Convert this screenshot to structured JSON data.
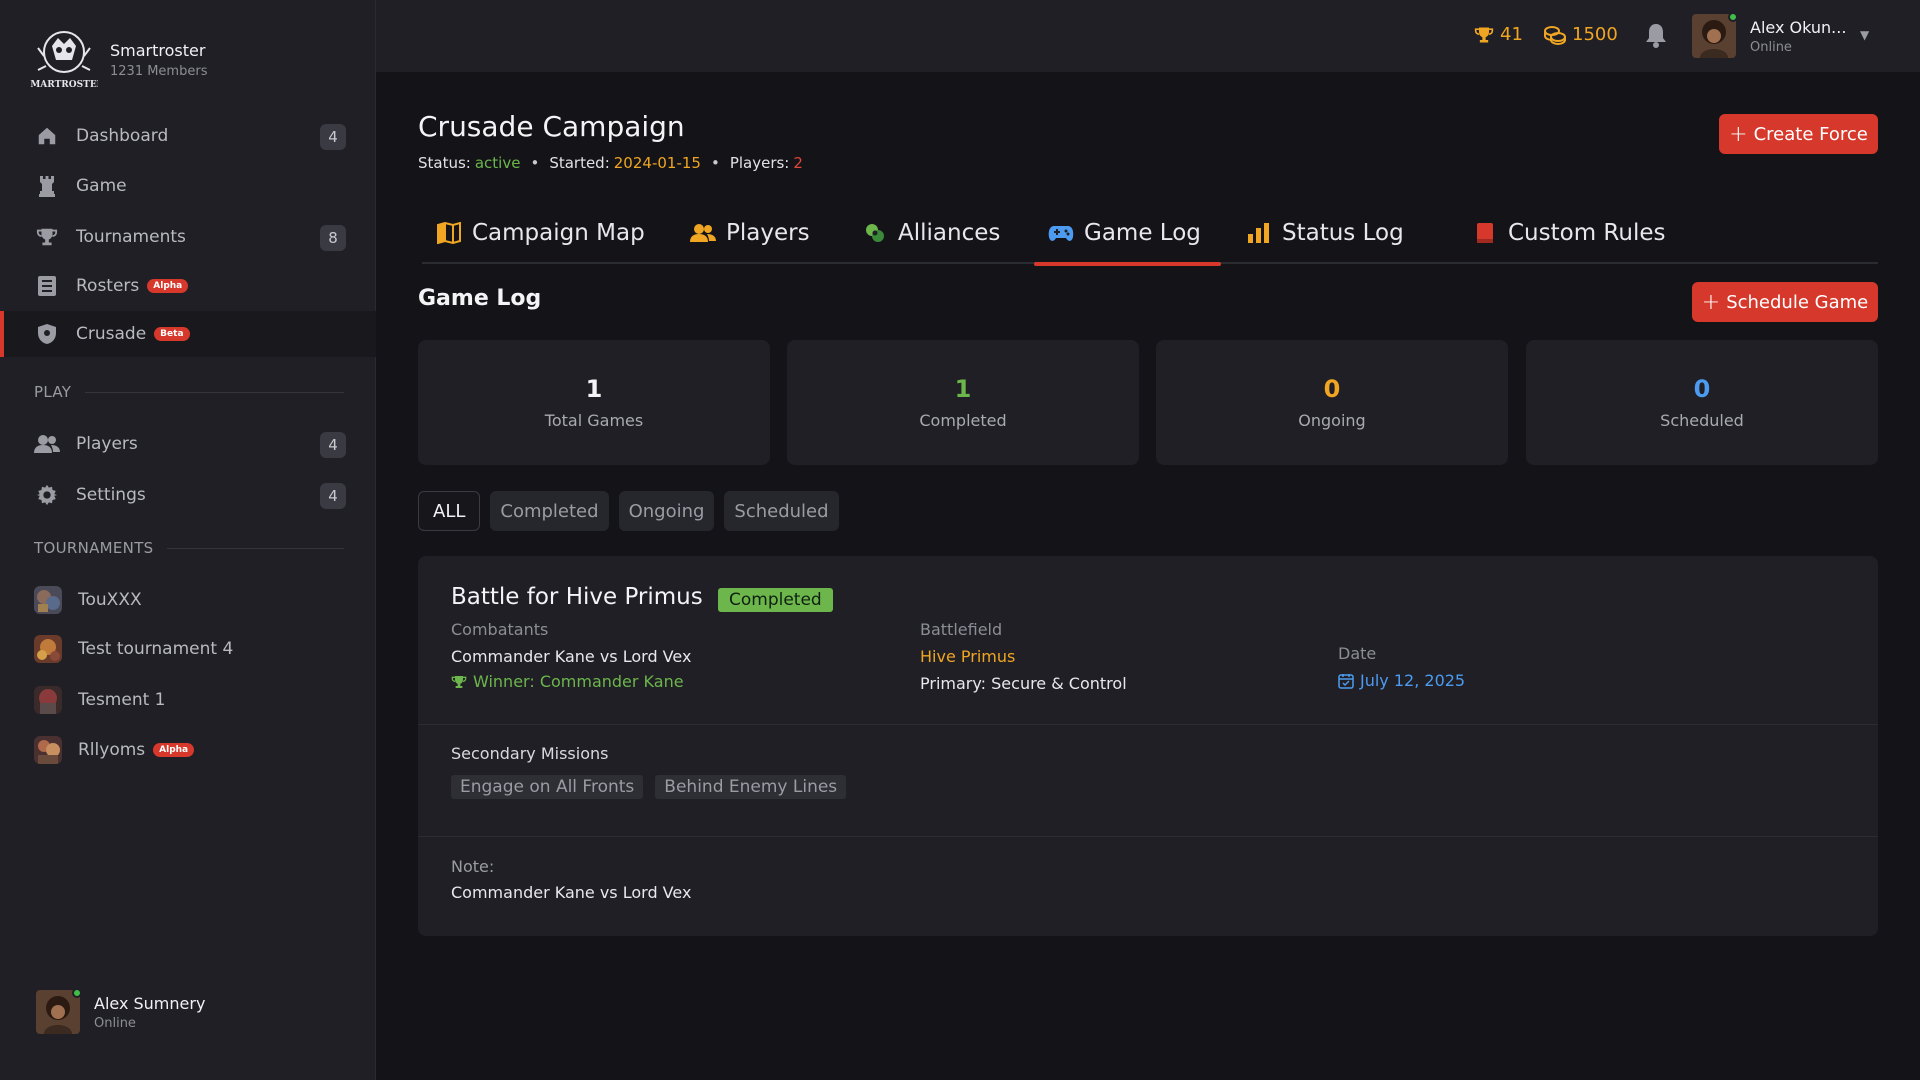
{
  "colors": {
    "accent": "#d6392c",
    "green": "#6cb64b",
    "orange": "#f0a623",
    "blue": "#4d9bf0",
    "sidebar_bg": "#1f1f25",
    "page_bg": "#131318"
  },
  "brand": {
    "name": "Smartroster",
    "members": "1231 Members",
    "logo_text": "SMARTROSTER"
  },
  "sidebar": {
    "items": [
      {
        "label": "Dashboard",
        "icon": "home-icon",
        "count": "4"
      },
      {
        "label": "Game",
        "icon": "chess-rook-icon"
      },
      {
        "label": "Tournaments",
        "icon": "trophy-icon",
        "count": "8"
      },
      {
        "label": "Rosters",
        "icon": "list-icon",
        "badge": "Alpha"
      },
      {
        "label": "Crusade",
        "icon": "shield-icon",
        "badge": "Beta",
        "active": true
      }
    ],
    "play_heading": "PLAY",
    "play_items": [
      {
        "label": "Players",
        "icon": "users-icon",
        "count": "4"
      },
      {
        "label": "Settings",
        "icon": "gear-icon",
        "count": "4"
      }
    ],
    "tournaments_heading": "TOURNAMENTS",
    "tournaments": [
      {
        "label": "TouXXX"
      },
      {
        "label": "Test tournament 4"
      },
      {
        "label": "Tesment 1"
      },
      {
        "label": "Rllyoms",
        "badge": "Alpha"
      }
    ],
    "user": {
      "name": "Alex Sumnery",
      "status": "Online"
    }
  },
  "topbar": {
    "trophies": "41",
    "coins": "1500",
    "user": {
      "name": "Alex Okun...",
      "status": "Online"
    }
  },
  "campaign": {
    "title": "Crusade Campaign",
    "status_label": "Status:",
    "status_value": "active",
    "started_label": "Started:",
    "started_value": "2024-01-15",
    "players_label": "Players:",
    "players_value": "2",
    "create_force_label": "Create Force"
  },
  "tabs": [
    {
      "label": "Campaign Map",
      "icon": "map-icon"
    },
    {
      "label": "Players",
      "icon": "users-icon"
    },
    {
      "label": "Alliances",
      "icon": "alliance-icon"
    },
    {
      "label": "Game Log",
      "icon": "gamepad-icon",
      "active": true
    },
    {
      "label": "Status Log",
      "icon": "bar-chart-icon"
    },
    {
      "label": "Custom Rules",
      "icon": "book-icon"
    }
  ],
  "game_log": {
    "title": "Game Log",
    "schedule_label": "Schedule Game",
    "stats": [
      {
        "value": "1",
        "label": "Total Games",
        "color": "#f4f4f6"
      },
      {
        "value": "1",
        "label": "Completed",
        "color": "#6cb64b"
      },
      {
        "value": "0",
        "label": "Ongoing",
        "color": "#f0a623"
      },
      {
        "value": "0",
        "label": "Scheduled",
        "color": "#4d9bf0"
      }
    ],
    "filters": [
      "ALL",
      "Completed",
      "Ongoing",
      "Scheduled"
    ],
    "active_filter": "ALL",
    "games": [
      {
        "title": "Battle for Hive Primus",
        "status": "Completed",
        "combatants_label": "Combatants",
        "combatants": "Commander Kane vs Lord Vex",
        "winner": "Winner: Commander Kane",
        "battlefield_label": "Battlefield",
        "battlefield": "Hive Primus",
        "primary": "Primary: Secure & Control",
        "date_label": "Date",
        "date": "July 12, 2025",
        "secondary_label": "Secondary Missions",
        "secondary": [
          "Engage on All Fronts",
          "Behind Enemy Lines"
        ],
        "note_label": "Note:",
        "note": "Commander Kane vs Lord Vex"
      }
    ]
  }
}
